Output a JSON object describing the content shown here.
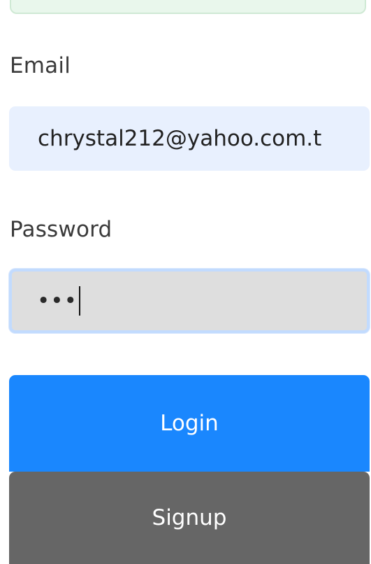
{
  "form": {
    "email": {
      "label": "Email",
      "value": "chrystal212@yahoo.com.t"
    },
    "password": {
      "label": "Password",
      "masked_value": "•••"
    },
    "buttons": {
      "login_label": "Login",
      "signup_label": "Signup"
    }
  },
  "colors": {
    "login_button": "#1a87fe",
    "signup_button": "#666666",
    "email_input_bg": "#e8f0fe",
    "password_input_bg": "#dedede",
    "password_focus_border": "#c2dbfe",
    "top_alert_bg": "#e9f7ec"
  }
}
